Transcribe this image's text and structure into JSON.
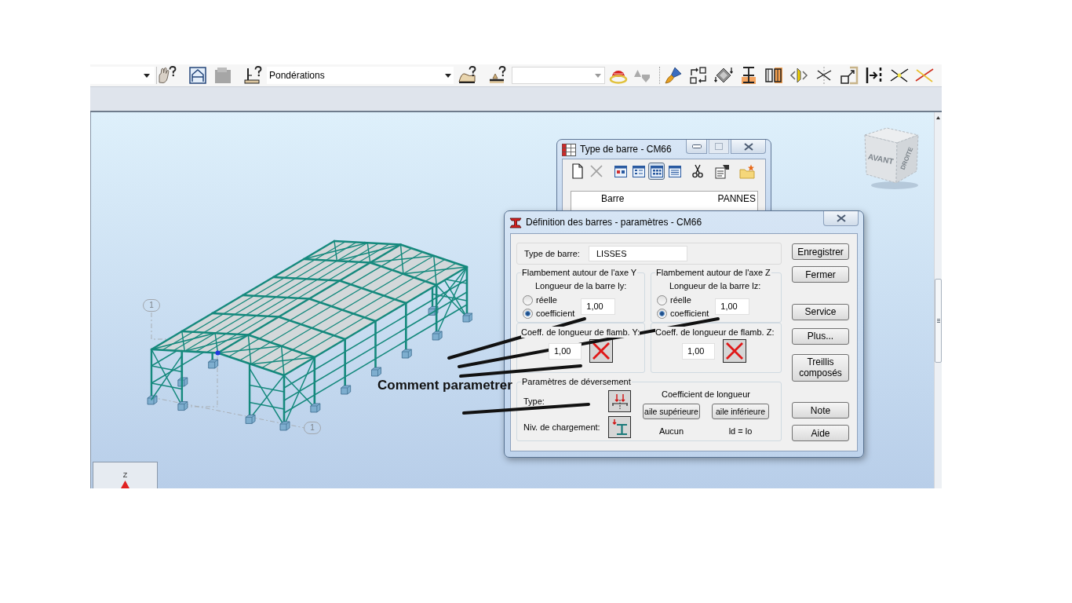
{
  "toolbar": {
    "combo": {
      "value": "Pondérations"
    }
  },
  "viewport": {
    "grid_labels": [
      "1",
      "1"
    ],
    "view_cube": {
      "front": "AVANT",
      "right": "DROITE"
    },
    "axis_label": "Z",
    "annotation": "Comment parametrer"
  },
  "type_window": {
    "title": "Type de barre - CM66",
    "maximize": {
      "disabled": true
    },
    "view_buttons": [
      {
        "selected": false
      },
      {
        "selected": false
      },
      {
        "selected": true
      },
      {
        "selected": false
      }
    ],
    "rows": [
      {
        "label": "Barre",
        "value": "PANNES"
      }
    ]
  },
  "dialog": {
    "title": "Définition des barres - paramètres - CM66",
    "bar_type": {
      "label": "Type de barre:",
      "value": "LISSES"
    },
    "buckling": [
      {
        "title": "Flambement autour de l'axe Y",
        "length_label": "Longueur de la barre ly:",
        "options": [
          {
            "label": "réelle",
            "selected": false
          },
          {
            "label": "coefficient",
            "selected": true
          }
        ],
        "length_value": "1,00",
        "coeff_label": "Coeff. de longueur de flamb. Y:",
        "coeff_value": "1,00"
      },
      {
        "title": "Flambement autour de l'axe Z",
        "length_label": "Longueur de la barre lz:",
        "options": [
          {
            "label": "réelle",
            "selected": false
          },
          {
            "label": "coefficient",
            "selected": true
          }
        ],
        "length_value": "1,00",
        "coeff_label": "Coeff. de longueur de flamb. Z:",
        "coeff_value": "1,00"
      }
    ],
    "lateral_buckling": {
      "title": "Paramètres de déversement",
      "type_label": "Type:",
      "load_level_label": "Niv. de chargement:",
      "length_title": "Coefficient de longueur",
      "flanges": [
        {
          "button": "aile supérieure",
          "value": "Aucun"
        },
        {
          "button": "aile inférieure",
          "value": "ld = lo"
        }
      ]
    },
    "button_groups": [
      [
        "Enregistrer",
        "Fermer"
      ],
      [
        "Service",
        "Plus...",
        "Treillis composés"
      ],
      [
        "Note",
        "Aide"
      ]
    ]
  }
}
